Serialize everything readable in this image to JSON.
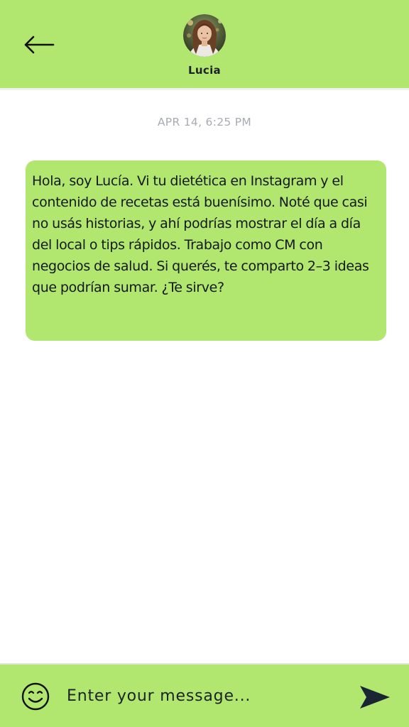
{
  "header": {
    "contact_name": "Lucia",
    "back_icon": "arrow-left-icon",
    "avatar_alt": "Lucia profile photo"
  },
  "conversation": {
    "timestamp": "APR 14, 6:25 PM",
    "messages": [
      {
        "text": "Hola, soy Lucía. Vi tu dietética en Instagram y el contenido de recetas está buenísimo. Noté que casi no usás historias, y ahí podrías mostrar el día a día del local o tips rápidos. Trabajo como CM con negocios de salud. Si querés, te comparto 2–3 ideas que podrían sumar. ¿Te sirve?"
      }
    ]
  },
  "composer": {
    "placeholder": "Enter your message...",
    "value": "",
    "emoji_icon": "smiley-icon",
    "send_icon": "send-arrow-icon"
  },
  "colors": {
    "accent": "#b1e76f",
    "timestamp": "#a8abb1",
    "text": "#15181b",
    "icon_dark": "#1b2433"
  }
}
